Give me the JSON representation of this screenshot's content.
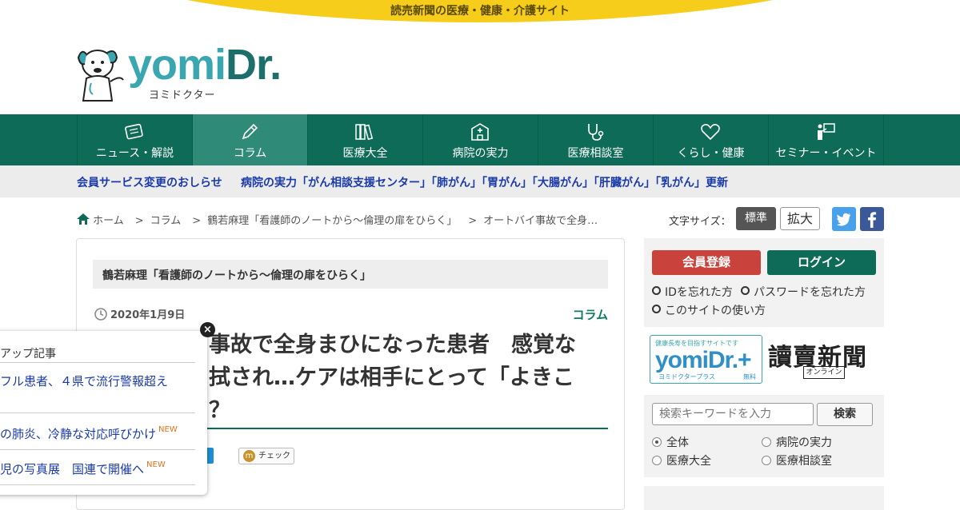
{
  "tagline": "読売新聞の医療・健康・介護サイト",
  "logo": {
    "yomi": "yomi",
    "dr": "Dr.",
    "kana": "ヨミドクター"
  },
  "colors": {
    "brand_green": "#0d6b57",
    "accent_yellow": "#f7cd1b",
    "link_blue": "#1a3aa8",
    "register_red": "#c9423c"
  },
  "nav": [
    {
      "label": "ニュース・解説",
      "icon": "newspaper-icon"
    },
    {
      "label": "コラム",
      "icon": "pencil-icon",
      "active": true
    },
    {
      "label": "医療大全",
      "icon": "books-icon"
    },
    {
      "label": "病院の実力",
      "icon": "hospital-icon"
    },
    {
      "label": "医療相談室",
      "icon": "stethoscope-icon"
    },
    {
      "label": "くらし・健康",
      "icon": "heart-icon"
    },
    {
      "label": "セミナー・イベント",
      "icon": "presenter-icon"
    }
  ],
  "notice": {
    "membership": "会員サービス変更のおしらせ",
    "hospital": "病院の実力「がん相談支援センター」「肺がん」「胃がん」「大腸がん」「肝臓がん」「乳がん」更新"
  },
  "breadcrumb": {
    "home": "ホーム",
    "column": "コラム",
    "series": "鶴若麻理「看護師のノートから～倫理の扉をひらく」",
    "current": "オートバイ事故で全身…"
  },
  "font_size": {
    "label": "文字サイズ：",
    "standard": "標準",
    "large": "拡大"
  },
  "article": {
    "series_title": "鶴若麻理「看護師のノートから～倫理の扉をひらく」",
    "date": "2020年1月9日",
    "category": "コラム",
    "headline_lines": [
      "事故で全身まひになった患者　感覚な",
      "拭され…ケアは相手にとって「よきこ",
      "？"
    ],
    "check_label": "チェック"
  },
  "popup": {
    "title": "アップ記事",
    "items": [
      {
        "text": "フル患者、４県で流行警報超え",
        "new": false
      },
      {
        "text": "の肺炎、冷静な対応呼びかけ",
        "new": true
      },
      {
        "text": "児の写真展　国連で開催へ",
        "new": true
      }
    ],
    "new_label": "NEW",
    "close": "×"
  },
  "account": {
    "register": "会員登録",
    "login": "ログイン",
    "forgot_id": "IDを忘れた方",
    "forgot_password": "パスワードを忘れた方",
    "how_to_use": "このサイトの使い方"
  },
  "banners": {
    "plus_tag": "健康長寿を目指すサイトです",
    "plus_logo": "yomiDr.+",
    "plus_sub": "ヨミドクタープラス",
    "plus_free": "無料",
    "yomiuri": "讀賣新聞",
    "yomiuri_online": "オンライン"
  },
  "search": {
    "placeholder": "検索キーワードを入力",
    "button": "検索",
    "options": [
      {
        "label": "全体",
        "checked": true
      },
      {
        "label": "病院の実力",
        "checked": false
      },
      {
        "label": "医療大全",
        "checked": false
      },
      {
        "label": "医療相談室",
        "checked": false
      }
    ]
  }
}
